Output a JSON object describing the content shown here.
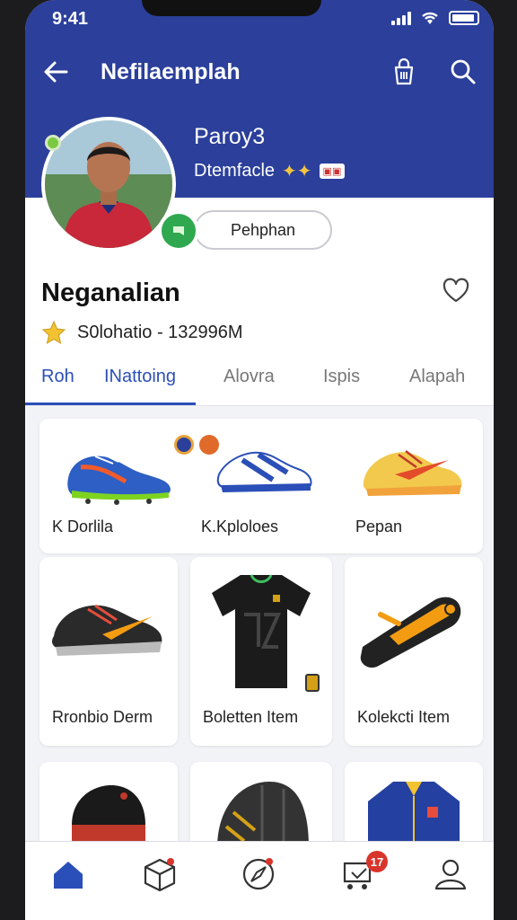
{
  "status_bar": {
    "time": "9:41"
  },
  "app_bar": {
    "title": "Nefilaemplah"
  },
  "profile": {
    "name": "Paroy3",
    "subtitle": "Dtemfacle",
    "follow_label": "Pehphan"
  },
  "section": {
    "title": "Neganalian",
    "rating_text": "S0lohatio - 132996M"
  },
  "tabs": [
    {
      "label": "Roh",
      "active": false
    },
    {
      "label": "INattoing",
      "active": true
    },
    {
      "label": "Alovra",
      "active": false
    },
    {
      "label": "Ispis",
      "active": false
    },
    {
      "label": "Alapah",
      "active": false
    }
  ],
  "products": [
    {
      "label": "K Dorlila",
      "icon": "soccer-cleat-icon"
    },
    {
      "label": "K.Kploloes",
      "icon": "sneaker-icon"
    },
    {
      "label": "Pepan",
      "icon": "running-shoe-icon"
    },
    {
      "label": "Rronbio Derm",
      "icon": "shoe-icon"
    },
    {
      "label": "Boletten Item",
      "icon": "jersey-icon"
    },
    {
      "label": "Kolekcti Item",
      "icon": "shin-guard-icon"
    }
  ],
  "bottom_nav": [
    {
      "name": "home",
      "icon": "home-icon",
      "active": true
    },
    {
      "name": "box",
      "icon": "box-icon"
    },
    {
      "name": "compass",
      "icon": "compass-icon"
    },
    {
      "name": "cart",
      "icon": "cart-icon",
      "badge": "17"
    },
    {
      "name": "profile",
      "icon": "user-icon"
    }
  ],
  "colors": {
    "primary": "#2b3f9b",
    "tab_active": "#2b4fb8",
    "badge": "#d9342b",
    "verify": "#2fa84f"
  }
}
